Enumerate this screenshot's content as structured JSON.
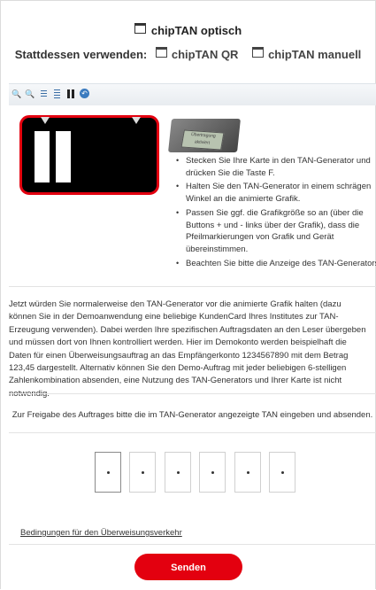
{
  "header": {
    "title": "chipTAN optisch",
    "alt_label": "Stattdessen verwenden:",
    "alt_links": [
      "chipTAN QR",
      "chipTAN manuell"
    ]
  },
  "toolbar": {
    "buttons": [
      "zoom-in",
      "zoom-out",
      "narrow",
      "widen",
      "pause",
      "back"
    ]
  },
  "device_screen_text": "Übertragung aktiviert",
  "instructions": [
    "Stecken Sie Ihre Karte in den TAN-Generator und drücken Sie die Taste F.",
    "Halten Sie den TAN-Generator in einem schrägen Winkel an die animierte Grafik.",
    "Passen Sie ggf. die Grafikgröße so an (über die Buttons + und - links über der Grafik), dass die Pfeilmarkierungen von Grafik und Gerät übereinstimmen.",
    "Beachten Sie bitte die Anzeige des TAN-Generators."
  ],
  "description": "Jetzt würden Sie normalerweise den TAN-Generator vor die animierte Grafik halten (dazu können Sie in der Demoanwendung eine beliebige KundenCard Ihres Institutes zur TAN-Erzeugung verwenden). Dabei werden Ihre spezifischen Auftragsdaten an den Leser übergeben und müssen dort von Ihnen kontrolliert werden. Hier im Demokonto werden beispielhaft die Daten für einen Überweisungsauftrag an das Empfängerkonto 1234567890 mit dem Betrag 123,45 dargestellt. Alternativ können Sie den Demo-Auftrag mit jeder beliebigen 6-stelligen Zahlenkombination absenden, eine Nutzung des TAN-Generators und Ihrer Karte ist nicht notwendig.",
  "tan_prompt": "Zur Freigabe des Auftrages bitte die im TAN-Generator angezeigte TAN eingeben und absenden.",
  "tan_fields": 6,
  "terms_link": "Bedingungen für den Überweisungsverkehr",
  "submit_label": "Senden",
  "colors": {
    "accent": "#e3000f",
    "toolbar": "#eef1f4"
  }
}
